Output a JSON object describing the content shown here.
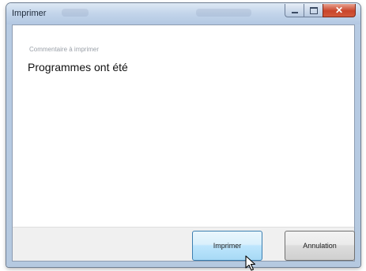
{
  "window": {
    "title": "Imprimer"
  },
  "content": {
    "caption": "Commentaire à imprimer",
    "comment": "Programmes ont été"
  },
  "buttons": {
    "print_label": "Imprimer",
    "cancel_label": "Annulation"
  },
  "icons": {
    "minimize": "minimize-icon",
    "maximize": "maximize-icon",
    "close": "close-icon",
    "cursor": "mouse-pointer-icon"
  },
  "colors": {
    "close_button": "#c9452b",
    "print_button_border": "#3c7fb1"
  }
}
